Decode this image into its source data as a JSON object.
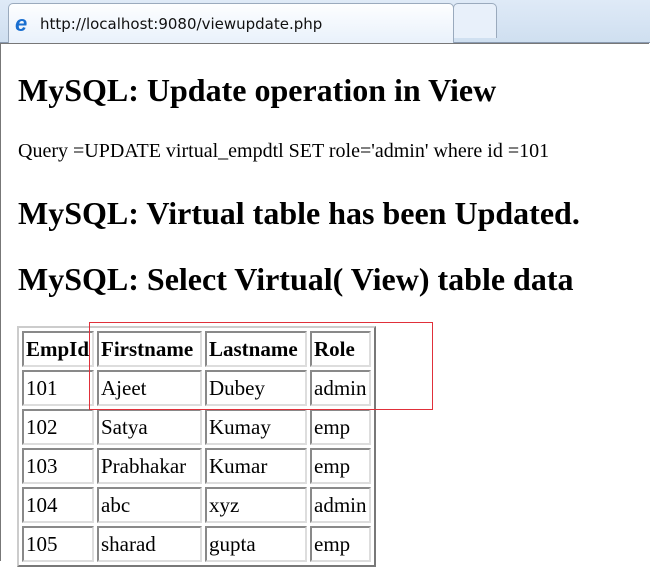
{
  "browser": {
    "tab_title": "http://localhost:9080/viewupdate.php",
    "icon": "ie-icon"
  },
  "page": {
    "heading1": "MySQL: Update operation in View",
    "query": "Query =UPDATE virtual_empdtl SET role='admin' where id =101",
    "heading2": "MySQL: Virtual table has been Updated.",
    "heading3": "MySQL: Select Virtual( View) table data"
  },
  "table": {
    "headers": [
      "EmpId",
      "Firstname",
      "Lastname",
      "Role"
    ],
    "rows": [
      [
        "101",
        "Ajeet",
        "Dubey",
        "admin"
      ],
      [
        "102",
        "Satya",
        "Kumay",
        "emp"
      ],
      [
        "103",
        "Prabhakar",
        "Kumar",
        "emp"
      ],
      [
        "104",
        "abc",
        "xyz",
        "admin"
      ],
      [
        "105",
        "sharad",
        "gupta",
        "emp"
      ]
    ]
  },
  "highlight_color": "#e0303a"
}
